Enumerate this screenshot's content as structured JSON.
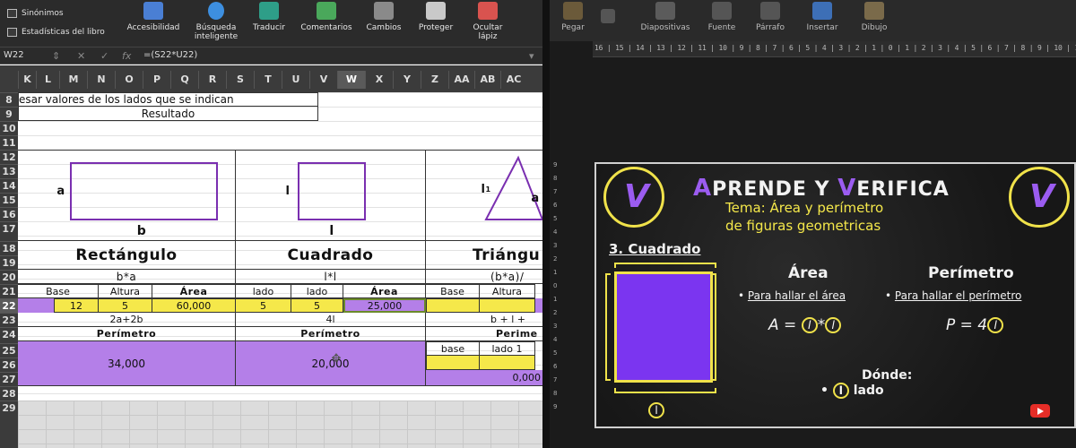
{
  "excel": {
    "ribbon_left": [
      "Sinónimos",
      "Estadísticas del libro"
    ],
    "ribbon_buttons": [
      {
        "label": "Accesibilidad",
        "icon": "accessibility-icon"
      },
      {
        "label": "Búsqueda\ninteligente",
        "icon": "smart-lookup-icon"
      },
      {
        "label": "Traducir",
        "icon": "translate-icon"
      },
      {
        "label": "Comentarios",
        "icon": "comments-icon"
      },
      {
        "label": "Cambios",
        "icon": "track-changes-icon"
      },
      {
        "label": "Proteger",
        "icon": "protect-icon"
      },
      {
        "label": "Ocultar\nlápiz",
        "icon": "hide-ink-icon"
      }
    ],
    "name_box": "W22",
    "formula": "=(S22*U22)",
    "fx": "fx",
    "columns": [
      "K",
      "L",
      "M",
      "N",
      "O",
      "P",
      "Q",
      "R",
      "S",
      "T",
      "U",
      "V",
      "W",
      "X",
      "Y",
      "Z",
      "AA",
      "AB",
      "AC"
    ],
    "selected_column": "W",
    "rows": [
      "8",
      "9",
      "10",
      "11",
      "12",
      "13",
      "14",
      "15",
      "16",
      "17",
      "18",
      "19",
      "20",
      "21",
      "22",
      "23",
      "24",
      "25",
      "26",
      "27",
      "28",
      "29"
    ],
    "selected_row": "22",
    "cells": {
      "instruction": "esar valores de los lados que se indican",
      "result": "Resultado",
      "rect_side_a": "a",
      "rect_side_b": "b",
      "sq_side_l": "l",
      "sq_side_l2": "l",
      "tri_side_l1": "l",
      "tri_side_l1_sub": "1",
      "tri_side_a": "a",
      "rect_title": "Rectángulo",
      "sq_title": "Cuadrado",
      "tri_title": "Triángu",
      "rect_formula": "b*a",
      "sq_formula": "l*l",
      "tri_formula": "(b*a)/",
      "rect_hdr": [
        "Base",
        "Altura",
        "Área"
      ],
      "sq_hdr": [
        "lado",
        "lado",
        "Área"
      ],
      "tri_hdr": [
        "Base",
        "Altura"
      ],
      "rect_vals": [
        "12",
        "5",
        "60,000"
      ],
      "sq_vals": [
        "5",
        "5",
        "25,000"
      ],
      "rect_perim_formula": "2a+2b",
      "sq_perim_formula": "4l",
      "tri_perim_formula": "b + l +",
      "perim_label": "Perímetro",
      "perim_label_tri": "Perime",
      "rect_perim": "34,000",
      "sq_perim": "20,000",
      "tri_hdr2": [
        "base",
        "lado 1"
      ],
      "tri_perim": "0,000"
    }
  },
  "ppt": {
    "ribbon_buttons": [
      {
        "label": "Pegar",
        "icon": "paste-icon"
      },
      {
        "label": "Diapositivas",
        "icon": "slides-icon"
      },
      {
        "label": "Fuente",
        "icon": "font-icon"
      },
      {
        "label": "Párrafo",
        "icon": "paragraph-icon"
      },
      {
        "label": "Insertar",
        "icon": "insert-icon"
      },
      {
        "label": "Dibujo",
        "icon": "drawing-icon"
      }
    ],
    "ruler": "16 | 15 | 14 | 13 | 12 | 11 | 10 | 9 | 8 | 7 | 6 | 5 | 4 | 3 | 2 | 1 | 0 | 1 | 2 | 3 | 4 | 5 | 6 | 7 | 8 | 9 | 10 | 11 | 12 | 13 | 14 | 15 | 16",
    "vruler": [
      "9",
      "8",
      "7",
      "6",
      "5",
      "4",
      "3",
      "2",
      "1",
      "0",
      "1",
      "2",
      "3",
      "4",
      "5",
      "6",
      "7",
      "8",
      "9"
    ],
    "slide": {
      "title_a": "A",
      "title_rest1": "PRENDE Y ",
      "title_v": "V",
      "title_rest2": "ERIFICA",
      "subtitle1": "Tema: Área y perímetro",
      "subtitle2": "de figuras geometricas",
      "section": "3. Cuadrado",
      "area_title": "Área",
      "perim_title": "Perímetro",
      "area_hint": "Para hallar el área",
      "perim_hint": "Para hallar el perímetro",
      "area_formula_a": "A = ",
      "area_formula_l1": "l",
      "area_formula_times": "*",
      "area_formula_l2": "l",
      "perim_formula": "P = 4",
      "perim_formula_l": "l",
      "donde": "Dónde:",
      "lado": "lado",
      "lado_l": "l",
      "square_l": "l",
      "logo_letter": "V"
    }
  }
}
